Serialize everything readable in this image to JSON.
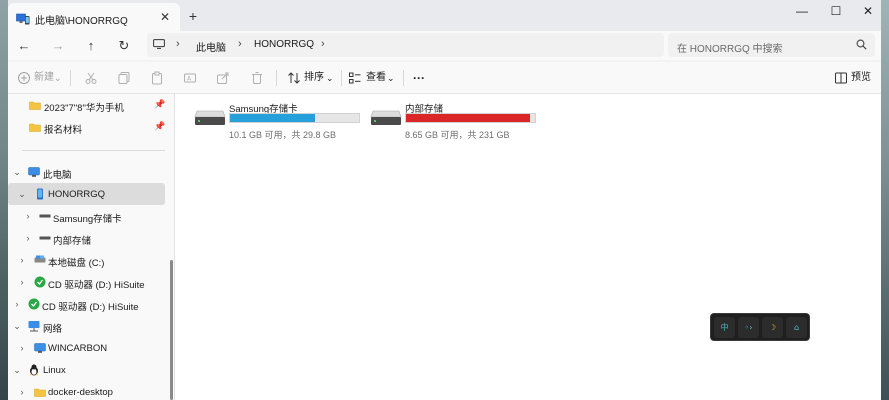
{
  "window": {
    "tab_title": "此电脑\\HONORRGQ",
    "tab_close": "✕",
    "new_tab": "+",
    "controls": {
      "minimize": "—",
      "maximize": "☐",
      "close": "✕"
    }
  },
  "nav": {
    "back": "←",
    "forward": "→",
    "up": "↑",
    "refresh": "↻",
    "breadcrumbs": [
      "此电脑",
      "HONORRGQ"
    ],
    "separator": "›",
    "search_placeholder": "在 HONORRGQ 中搜索"
  },
  "commands": {
    "new_label": "新建",
    "sort_label": "排序",
    "view_label": "查看",
    "more_label": "···",
    "preview_label": "预览",
    "dropdown": "⌄"
  },
  "sidebar": {
    "items": [
      {
        "label": "2023\"7\"8\"华为手机",
        "icon": "folder-icon",
        "pinned": true
      },
      {
        "label": "报名材料",
        "icon": "folder-icon",
        "pinned": true
      },
      {
        "label": "此电脑",
        "icon": "computer-icon",
        "expanded": true
      },
      {
        "label": "HONORRGQ",
        "icon": "phone-icon",
        "expanded": true,
        "selected": true
      },
      {
        "label": "Samsung存储卡",
        "icon": "drive-icon",
        "expanded": false
      },
      {
        "label": "内部存储",
        "icon": "drive-icon",
        "expanded": false
      },
      {
        "label": "本地磁盘 (C:)",
        "icon": "disk-icon",
        "expanded": false
      },
      {
        "label": "CD 驱动器 (D:) HiSuite",
        "icon": "hisuite-icon",
        "expanded": false
      },
      {
        "label": "CD 驱动器 (D:) HiSuite",
        "icon": "hisuite-icon",
        "expanded": false
      },
      {
        "label": "网络",
        "icon": "network-icon",
        "expanded": true
      },
      {
        "label": "WINCARBON",
        "icon": "monitor-icon",
        "expanded": false
      },
      {
        "label": "Linux",
        "icon": "linux-icon",
        "expanded": true
      },
      {
        "label": "docker-desktop",
        "icon": "folder-icon",
        "expanded": false
      }
    ]
  },
  "drives": [
    {
      "name": "Samsung存储卡",
      "info": "10.1 GB 可用，共 29.8 GB",
      "used_fraction": 0.66,
      "color": "#26a0da"
    },
    {
      "name": "内部存储",
      "info": "8.65 GB 可用，共 231 GB",
      "used_fraction": 0.96,
      "color": "#da2626"
    }
  ],
  "ime": {
    "buttons": [
      "中",
      "◦›",
      "☽",
      "⌂"
    ],
    "colors": [
      "#3fb8c9",
      "#4fc3d1",
      "#e6c229",
      "#4fc3d1"
    ]
  }
}
